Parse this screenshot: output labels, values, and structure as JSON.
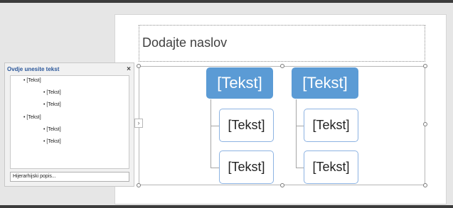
{
  "slide": {
    "title_placeholder": "Dodajte naslov",
    "expand_glyph": "›"
  },
  "text_pane": {
    "title": "Ovdje unesite tekst",
    "close_glyph": "×",
    "items": [
      {
        "bullet": "•",
        "text": "[Tekst]",
        "level": 1
      },
      {
        "bullet": "•",
        "text": "[Tekst]",
        "level": 2
      },
      {
        "bullet": "•",
        "text": "[Tekst]",
        "level": 2
      },
      {
        "bullet": "•",
        "text": "[Tekst]",
        "level": 1
      },
      {
        "bullet": "•",
        "text": "[Tekst]",
        "level": 2
      },
      {
        "bullet": "•",
        "text": "[Tekst]",
        "level": 2
      }
    ],
    "footer": "Hijerarhijski popis..."
  },
  "smartart": {
    "groups": [
      {
        "title": "[Tekst]",
        "children": [
          "[Tekst]",
          "[Tekst]"
        ]
      },
      {
        "title": "[Tekst]",
        "children": [
          "[Tekst]",
          "[Tekst]"
        ]
      }
    ]
  },
  "colors": {
    "accent": "#5b9bd5",
    "child_border": "#8db3e2",
    "connector": "#a6a6a6",
    "pane_title": "#2b579a"
  }
}
